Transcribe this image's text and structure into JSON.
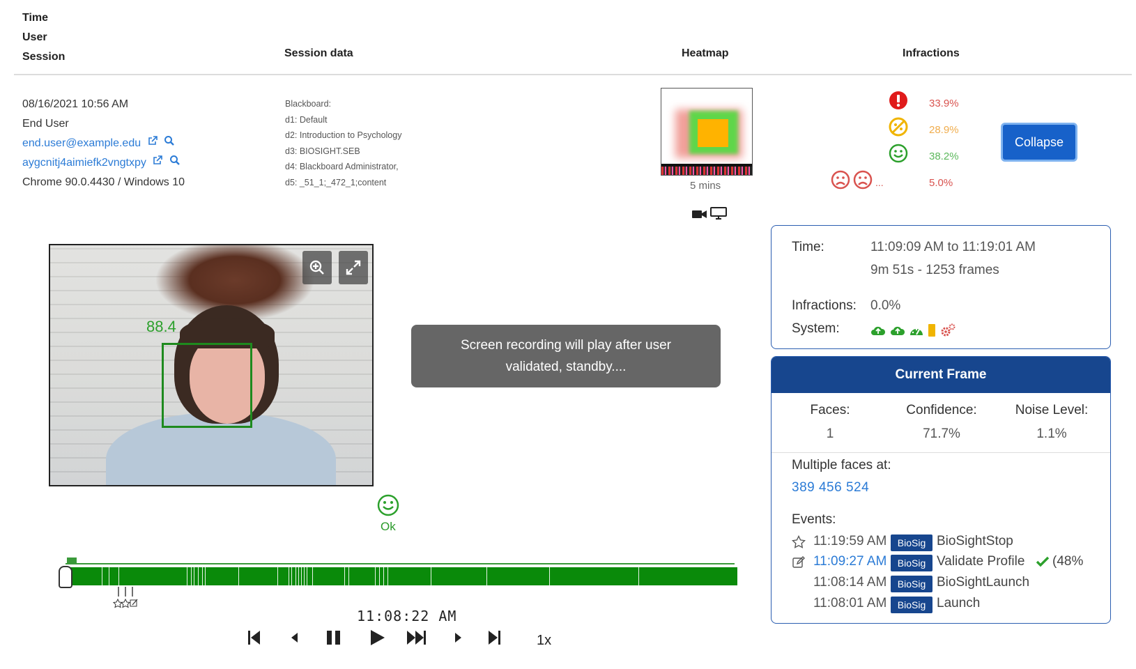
{
  "header": {
    "time": "Time",
    "user": "User",
    "session": "Session",
    "session_data": "Session data",
    "heatmap": "Heatmap",
    "infractions": "Infractions"
  },
  "session": {
    "datetime": "08/16/2021 10:56 AM",
    "user_name": "End User",
    "email": "end.user@example.edu",
    "user_id": "aygcnitj4aimiefk2vngtxpy",
    "browser": "Chrome 90.0.4430 / Windows 10"
  },
  "session_data": {
    "l0": "Blackboard:",
    "l1": "d1: Default",
    "l2": "d2: Introduction to Psychology",
    "l3": "d3: BIOSIGHT.SEB",
    "l4": "d4: Blackboard Administrator,",
    "l5": "d5: _51_1;_472_1;content"
  },
  "heatmap": {
    "label": "5 mins"
  },
  "infractions": {
    "red_pct": "33.9%",
    "yellow_pct": "28.9%",
    "green_pct": "38.2%",
    "other_pct": "5.0%",
    "other_ellipsis": "...",
    "colors": {
      "red": "#e01b1b",
      "yellow": "#f0b400",
      "green": "#2ca02c",
      "red_text": "#d9534f",
      "yellow_text": "#f0ad4e",
      "green_text": "#5cb85c"
    }
  },
  "collapse_button": "Collapse",
  "video": {
    "confidence": "88.4"
  },
  "toast": {
    "line1": "Screen recording will play after user",
    "line2": "validated, standby...."
  },
  "status": {
    "label": "Ok"
  },
  "timeline": {
    "time": "11:08:22 AM"
  },
  "controls": {
    "speed": "1x"
  },
  "summary": {
    "time_label": "Time:",
    "time_range": "11:09:09 AM to 11:19:01 AM",
    "duration": "9m 51s - 1253 frames",
    "infractions_label": "Infractions:",
    "infractions_value": "0.0%",
    "system_label": "System:"
  },
  "current_frame": {
    "title": "Current Frame",
    "faces_label": "Faces:",
    "faces_value": "1",
    "confidence_label": "Confidence:",
    "confidence_value": "71.7%",
    "noise_label": "Noise Level:",
    "noise_value": "1.1%",
    "multiple_faces_label": "Multiple faces at:",
    "multiple_faces_value": "389 456 524",
    "events_label": "Events:",
    "events": [
      {
        "time": "11:19:59 AM",
        "source": "BioSig",
        "name": "BioSightStop"
      },
      {
        "time": "11:09:27 AM",
        "source": "BioSig",
        "name": "Validate Profile",
        "extra": "(48%"
      },
      {
        "time": "11:08:14 AM",
        "source": "BioSig",
        "name": "BioSightLaunch"
      },
      {
        "time": "11:08:01 AM",
        "source": "BioSig",
        "name": "Launch"
      }
    ]
  }
}
